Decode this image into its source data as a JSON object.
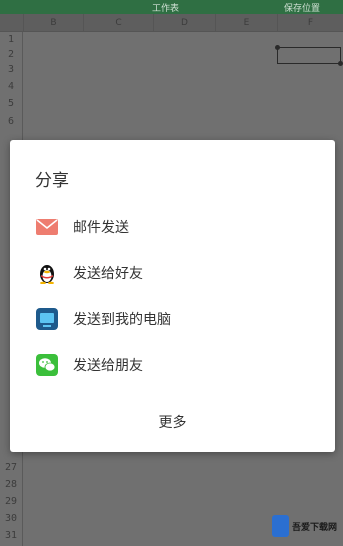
{
  "topbar": {
    "left_text": "工作表",
    "right_text": "保存位置"
  },
  "sheet": {
    "columns": [
      "B",
      "C",
      "D",
      "E",
      "F"
    ],
    "rows_top": [
      "1",
      "2",
      "3",
      "4",
      "5",
      "6"
    ],
    "rows_bottom": [
      "27",
      "28",
      "29",
      "30",
      "31"
    ]
  },
  "dialog": {
    "title": "分享",
    "items": [
      {
        "label": "邮件发送",
        "icon": "mail-icon"
      },
      {
        "label": "发送给好友",
        "icon": "qq-penguin-icon"
      },
      {
        "label": "发送到我的电脑",
        "icon": "my-computer-icon"
      },
      {
        "label": "发送给朋友",
        "icon": "wechat-icon"
      }
    ],
    "more_label": "更多"
  },
  "watermark": {
    "text": "吾爱下载网"
  },
  "colors": {
    "mail": "#ee7d70",
    "computer": "#2a93d8",
    "wechat": "#3bbf3b",
    "topbar": "#2f6f43"
  }
}
